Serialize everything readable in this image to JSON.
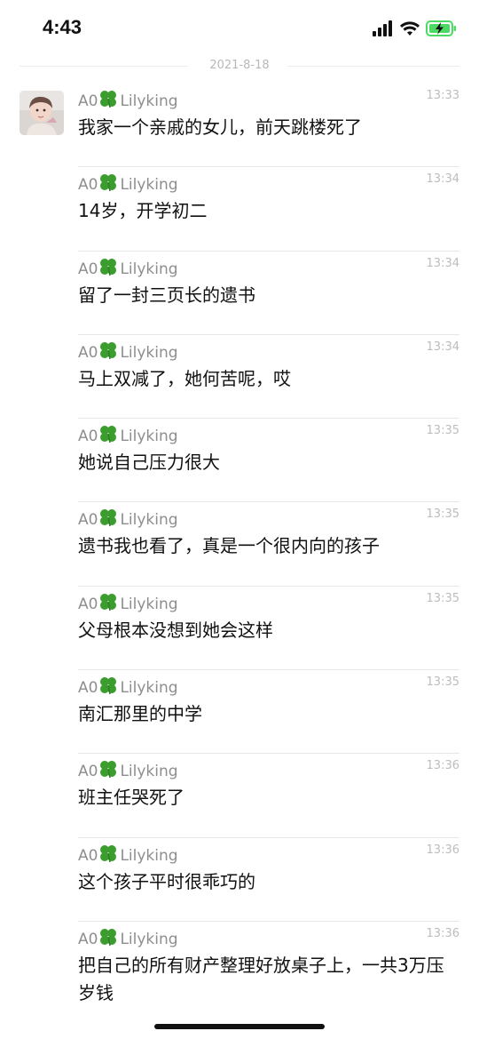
{
  "status_bar": {
    "time": "4:43"
  },
  "date_divider": "2021-8-18",
  "messages": [
    {
      "sender_prefix": "A0",
      "sender_name": "Lilyking",
      "time": "13:33",
      "text": "我家一个亲戚的女儿，前天跳楼死了"
    },
    {
      "sender_prefix": "A0",
      "sender_name": "Lilyking",
      "time": "13:34",
      "text": "14岁，开学初二"
    },
    {
      "sender_prefix": "A0",
      "sender_name": "Lilyking",
      "time": "13:34",
      "text": "留了一封三页长的遗书"
    },
    {
      "sender_prefix": "A0",
      "sender_name": "Lilyking",
      "time": "13:34",
      "text": "马上双减了，她何苦呢，哎"
    },
    {
      "sender_prefix": "A0",
      "sender_name": "Lilyking",
      "time": "13:35",
      "text": "她说自己压力很大"
    },
    {
      "sender_prefix": "A0",
      "sender_name": "Lilyking",
      "time": "13:35",
      "text": "遗书我也看了，真是一个很内向的孩子"
    },
    {
      "sender_prefix": "A0",
      "sender_name": "Lilyking",
      "time": "13:35",
      "text": "父母根本没想到她会这样"
    },
    {
      "sender_prefix": "A0",
      "sender_name": "Lilyking",
      "time": "13:35",
      "text": "南汇那里的中学"
    },
    {
      "sender_prefix": "A0",
      "sender_name": "Lilyking",
      "time": "13:36",
      "text": "班主任哭死了"
    },
    {
      "sender_prefix": "A0",
      "sender_name": "Lilyking",
      "time": "13:36",
      "text": "这个孩子平时很乖巧的"
    },
    {
      "sender_prefix": "A0",
      "sender_name": "Lilyking",
      "time": "13:36",
      "text": "把自己的所有财产整理好放桌子上，一共3万压岁钱"
    }
  ],
  "icons": {
    "sender_emoji": "four-leaf-clover-icon",
    "battery": "battery-charging-icon"
  },
  "colors": {
    "battery_green": "#4cd964",
    "clover_green": "#3a9d2e"
  }
}
